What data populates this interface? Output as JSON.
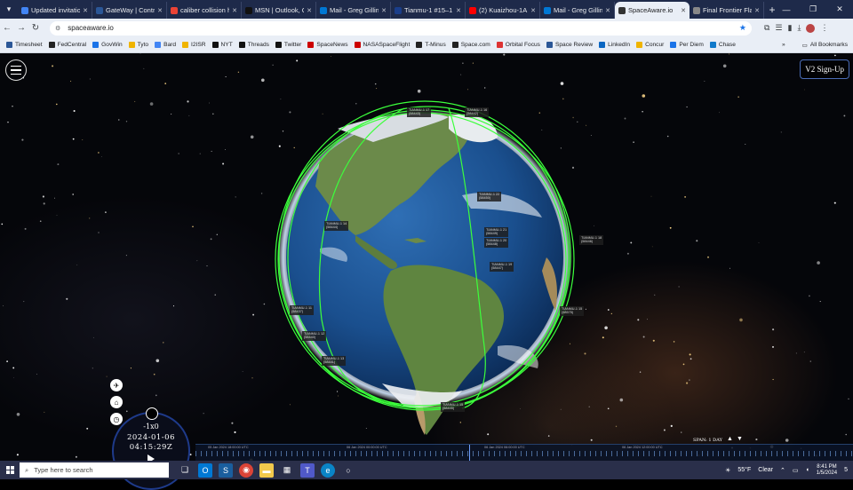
{
  "browser": {
    "tabs": [
      {
        "title": "Updated invitatio",
        "icon": "mail-icon",
        "color": "#4285f4"
      },
      {
        "title": "GateWay | Contr",
        "icon": "gateway-icon",
        "color": "#2b5797"
      },
      {
        "title": "caliber collision h",
        "icon": "google-icon",
        "color": "#ea4335"
      },
      {
        "title": "MSN | Outlook, O",
        "icon": "msn-icon",
        "color": "#111"
      },
      {
        "title": "Mail - Greg Gillin",
        "icon": "outlook-icon",
        "color": "#0078d4"
      },
      {
        "title": "Tianmu-1 #15–1",
        "icon": "n2yo-icon",
        "color": "#1a3e8a"
      },
      {
        "title": "(2) Kuaizhou-1A L",
        "icon": "youtube-icon",
        "color": "#ff0000"
      },
      {
        "title": "Mail - Greg Gillin",
        "icon": "outlook-icon",
        "color": "#0078d4"
      },
      {
        "title": "SpaceAware.io",
        "icon": "spaceaware-icon",
        "color": "#333"
      },
      {
        "title": "Final Frontier Fla",
        "icon": "page-icon",
        "color": "#888"
      }
    ],
    "url": "spaceaware.io",
    "bookmarks": [
      {
        "label": "Timesheet",
        "color": "#2b5797"
      },
      {
        "label": "FedCentral",
        "color": "#222"
      },
      {
        "label": "GovWin",
        "color": "#1a73e8"
      },
      {
        "label": "Tyto",
        "color": "#f0b400"
      },
      {
        "label": "Bard",
        "color": "#4285f4"
      },
      {
        "label": "I2ISR",
        "color": "#f0b400"
      },
      {
        "label": "NYT",
        "color": "#111"
      },
      {
        "label": "Threads",
        "color": "#111"
      },
      {
        "label": "Twitter",
        "color": "#111"
      },
      {
        "label": "SpaceNews",
        "color": "#c00"
      },
      {
        "label": "NASASpaceFlight",
        "color": "#c00"
      },
      {
        "label": "T-Minus",
        "color": "#222"
      },
      {
        "label": "Space.com",
        "color": "#222"
      },
      {
        "label": "Orbital Focus",
        "color": "#d33"
      },
      {
        "label": "Space Review",
        "color": "#2b5797"
      },
      {
        "label": "LinkedIn",
        "color": "#0a66c2"
      },
      {
        "label": "Concur",
        "color": "#f0b400"
      },
      {
        "label": "Per Diem",
        "color": "#1a73e8"
      },
      {
        "label": "Chase",
        "color": "#117aca"
      }
    ],
    "all_bookmarks": "All Bookmarks"
  },
  "app": {
    "signup_label": "V2 Sign-Up",
    "orbit_color": "#3cff3c",
    "satellites": [
      {
        "name": "TIANMU-1 17",
        "id": "(58443)"
      },
      {
        "name": "TIANMU-1 16",
        "id": "(58442)"
      },
      {
        "name": "TIANMU-1 22",
        "id": "(58450)"
      },
      {
        "name": "TIANMU-1 21",
        "id": "(58449)"
      },
      {
        "name": "TIANMU-1 20",
        "id": "(58448)"
      },
      {
        "name": "TIANMU-1 19",
        "id": "(58447)"
      },
      {
        "name": "TIANMU-1 18",
        "id": "(58446)"
      },
      {
        "name": "TIANMU-1 11",
        "id": "(58437)"
      },
      {
        "name": "TIANMU-1 12",
        "id": "(58440)"
      },
      {
        "name": "TIANMU-1 13",
        "id": "(58441)"
      },
      {
        "name": "TIANMU-1 15",
        "id": "(58445)"
      },
      {
        "name": "TIANMU-1 14",
        "id": "(58444)"
      },
      {
        "name": "TIANMU-1 15",
        "id": "(58575)"
      },
      {
        "name": "OBJECT D",
        "id": "(58576)"
      }
    ],
    "clock": {
      "multiplier": "-1x0",
      "date": "2024-01-06",
      "time": "04:15:29Z"
    },
    "timeline": {
      "labels": [
        "05 Jan 2024 18:00:00 UTC",
        "06 Jan 2024 00:00:00 UTC",
        "06 Jan 2024 06:00:00 UTC",
        "06 Jan 2024 12:00:00 UTC"
      ],
      "span_label": "SPAN: 1 DAY"
    }
  },
  "taskbar": {
    "search_placeholder": "Type here to search",
    "weather": "55°F",
    "weather_desc": "Clear",
    "time": "8:41 PM",
    "date": "1/5/2024",
    "notifications": "5"
  }
}
